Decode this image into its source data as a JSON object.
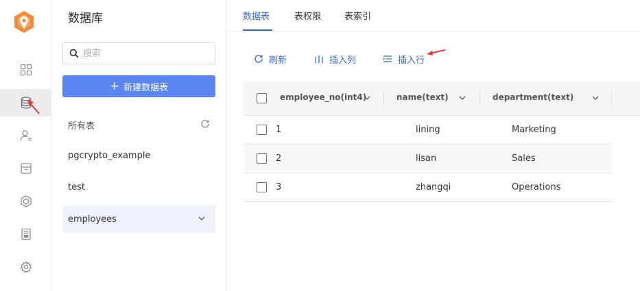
{
  "rail": {
    "items": [
      {
        "icon": "dashboard-icon"
      },
      {
        "icon": "database-icon",
        "active": true
      },
      {
        "icon": "user-icon"
      },
      {
        "icon": "storage-icon"
      },
      {
        "icon": "cube-icon"
      },
      {
        "icon": "api-icon"
      },
      {
        "icon": "gear-icon"
      }
    ]
  },
  "panel": {
    "title": "数据库",
    "search_placeholder": "搜索",
    "new_table_label": "新建数据表",
    "all_tables_label": "所有表",
    "tables": [
      {
        "name": "pgcrypto_example"
      },
      {
        "name": "test"
      },
      {
        "name": "employees",
        "active": true
      }
    ]
  },
  "main": {
    "tabs": [
      {
        "label": "数据表",
        "active": true
      },
      {
        "label": "表权限"
      },
      {
        "label": "表索引"
      }
    ],
    "toolbar": {
      "refresh_label": "刷新",
      "insert_column_label": "插入列",
      "insert_row_label": "插入行"
    },
    "columns": [
      "employee_no(int4)",
      "name(text)",
      "department(text)"
    ],
    "rows": [
      [
        "1",
        "lining",
        "Marketing"
      ],
      [
        "2",
        "lisan",
        "Sales"
      ],
      [
        "3",
        "zhangqi",
        "Operations"
      ]
    ]
  },
  "colors": {
    "accent": "#3a67d8",
    "button": "#5b86f2",
    "annotation_arrow": "#e53935"
  }
}
